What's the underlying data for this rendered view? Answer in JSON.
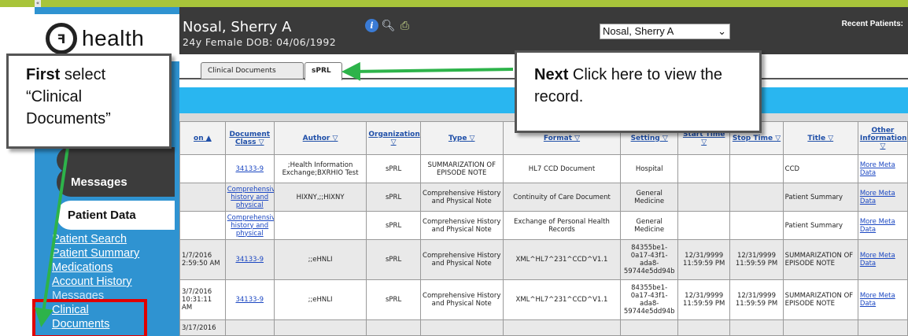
{
  "app": {
    "logo_text": "health",
    "collapse_marker": "«"
  },
  "header": {
    "patient_name": "Nosal, Sherry A",
    "demographics": "24y Female  DOB: 04/06/1992",
    "recent_label": "Recent Patients:",
    "recent_selected": "Nosal, Sherry A"
  },
  "tabs": [
    {
      "label": "Clinical Documents"
    },
    {
      "label": "sPRL"
    }
  ],
  "sidebar": {
    "messages": "Messages",
    "patient_data": "Patient Data",
    "links": [
      "Patient Search",
      "Patient Summary",
      "Medications",
      "Account History",
      "Messages",
      "Clinical",
      "Documents"
    ]
  },
  "callouts": {
    "first_bold": "First",
    "first_rest": " select “Clinical Documents”",
    "next_bold": "Next",
    "next_rest": " Click here to view the record."
  },
  "table": {
    "columns": [
      "on ▲",
      "Document Class ▽",
      "Author ▽",
      "Organization ▽",
      "Type ▽",
      "Format ▽",
      "Setting ▽",
      "Start Time ▽",
      "Stop Time ▽",
      "Title ▽",
      "Other Information ▽"
    ],
    "rows": [
      [
        "",
        "34133-9",
        ";Health Information Exchange;BXRHIO Test",
        "sPRL",
        "SUMMARIZATION OF EPISODE NOTE",
        "HL7 CCD Document",
        "Hospital",
        "",
        "",
        "CCD",
        "More Meta Data"
      ],
      [
        "",
        "Comprehensive history and physical",
        "HIXNY,;;HIXNY",
        "sPRL",
        "Comprehensive History and Physical Note",
        "Continuity of Care Document",
        "General Medicine",
        "",
        "",
        "Patient Summary",
        "More Meta Data"
      ],
      [
        "",
        "Comprehensive history and physical",
        "",
        "sPRL",
        "Comprehensive History and Physical Note",
        "Exchange of Personal Health Records",
        "General Medicine",
        "",
        "",
        "Patient Summary",
        "More Meta Data"
      ],
      [
        "1/7/2016 2:59:50 AM",
        "34133-9",
        ";;eHNLI",
        "sPRL",
        "Comprehensive History and Physical Note",
        "XML^HL7^231^CCD^V1.1",
        "84355be1-0a17-43f1-ada8-59744e5dd94b",
        "12/31/9999 11:59:59 PM",
        "12/31/9999 11:59:59 PM",
        "SUMMARIZATION OF EPISODE NOTE",
        "More Meta Data"
      ],
      [
        "3/7/2016 10:31:11 AM",
        "34133-9",
        ";;eHNLI",
        "sPRL",
        "Comprehensive History and Physical Note",
        "XML^HL7^231^CCD^V1.1",
        "84355be1-0a17-43f1-ada8-59744e5dd94b",
        "12/31/9999 11:59:59 PM",
        "12/31/9999 11:59:59 PM",
        "SUMMARIZATION OF EPISODE NOTE",
        "More Meta Data"
      ],
      [
        "3/17/2016",
        "",
        "",
        "",
        "",
        "",
        "",
        "",
        "",
        "",
        ""
      ]
    ]
  },
  "colors": {
    "accent_blue": "#29b6f0",
    "sidebar_blue": "#2f93d1",
    "header_dark": "#3a3a3a",
    "arrow_green": "#2db34a",
    "highlight_red": "#e00000"
  }
}
